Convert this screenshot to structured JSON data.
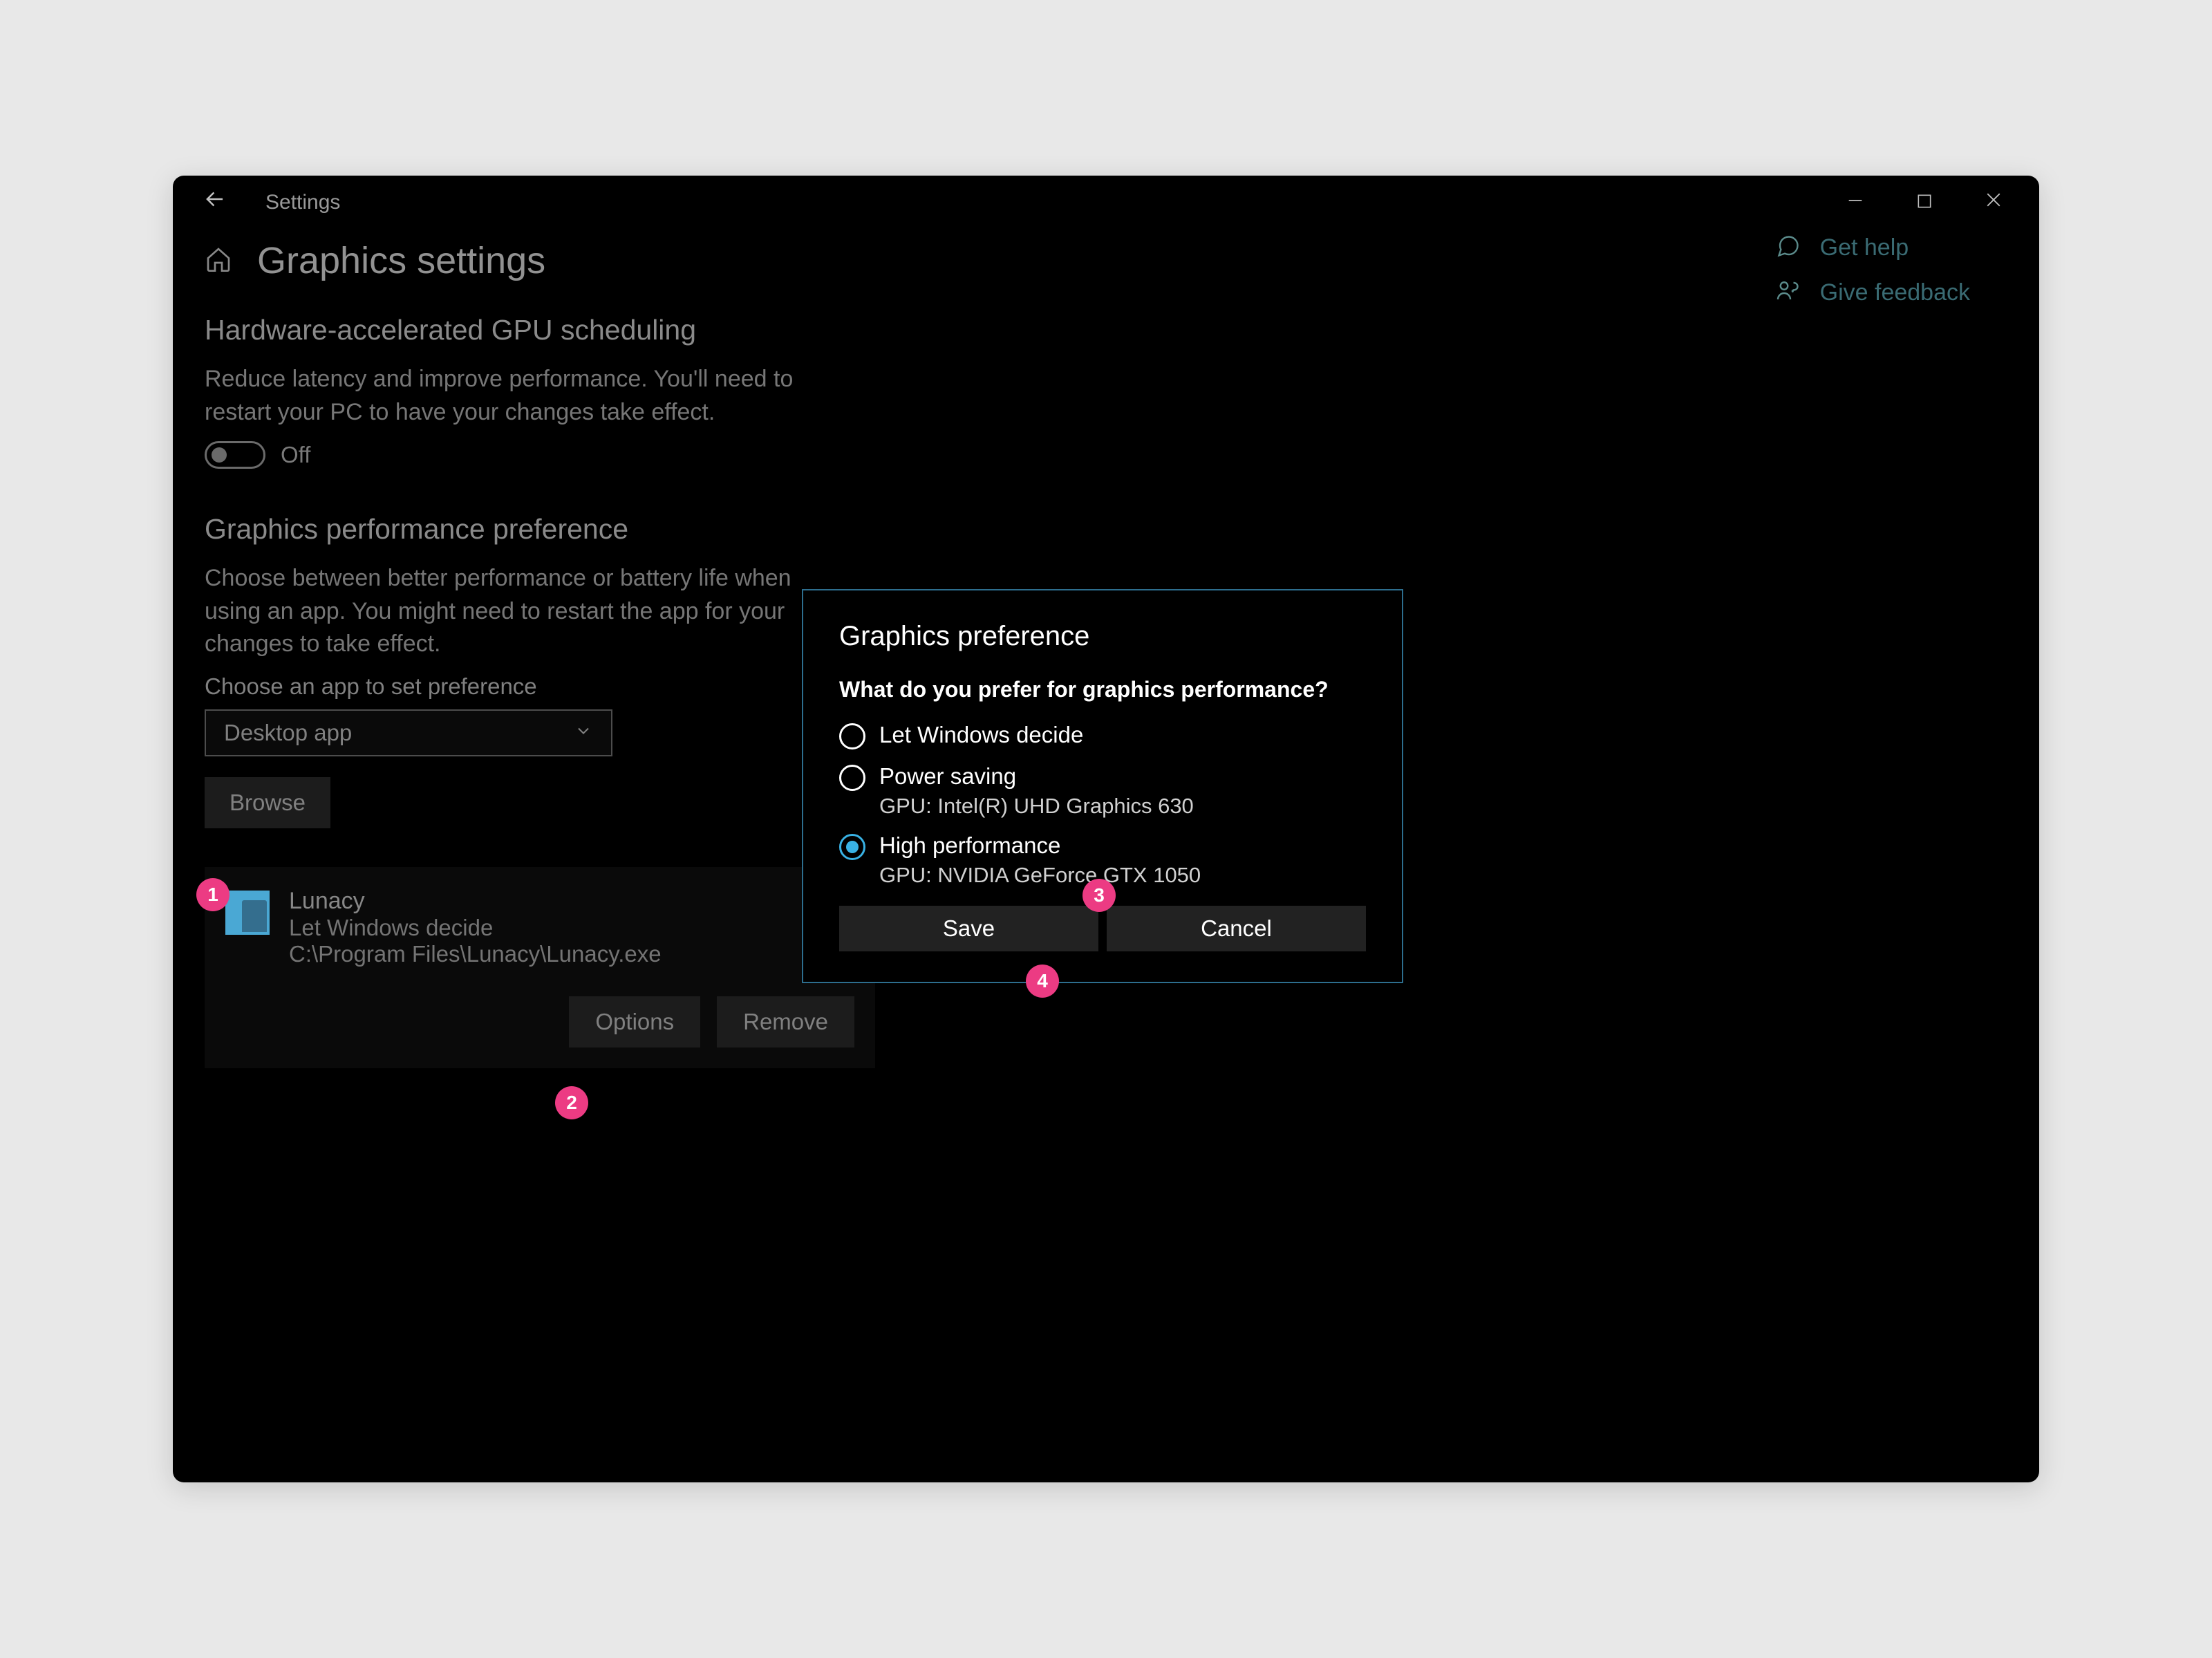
{
  "window": {
    "title": "Settings"
  },
  "page": {
    "title": "Graphics settings"
  },
  "gpu_scheduling": {
    "heading": "Hardware-accelerated GPU scheduling",
    "description": "Reduce latency and improve performance. You'll need to restart your PC to have your changes take effect.",
    "toggle_state": "Off"
  },
  "perf_pref": {
    "heading": "Graphics performance preference",
    "description": "Choose between better performance or battery life when using an app. You might need to restart the app for your changes to take effect.",
    "choose_label": "Choose an app to set preference",
    "dropdown_value": "Desktop app",
    "browse_label": "Browse"
  },
  "app": {
    "name": "Lunacy",
    "preference": "Let Windows decide",
    "path": "C:\\Program Files\\Lunacy\\Lunacy.exe",
    "options_label": "Options",
    "remove_label": "Remove"
  },
  "right": {
    "help": "Get help",
    "feedback": "Give feedback"
  },
  "dialog": {
    "title": "Graphics preference",
    "question": "What do you prefer for graphics performance?",
    "options": [
      {
        "label": "Let Windows decide",
        "sub": "",
        "selected": false
      },
      {
        "label": "Power saving",
        "sub": "GPU: Intel(R) UHD Graphics 630",
        "selected": false
      },
      {
        "label": "High performance",
        "sub": "GPU: NVIDIA GeForce GTX 1050",
        "selected": true
      }
    ],
    "save_label": "Save",
    "cancel_label": "Cancel"
  },
  "badges": {
    "b1": "1",
    "b2": "2",
    "b3": "3",
    "b4": "4"
  }
}
